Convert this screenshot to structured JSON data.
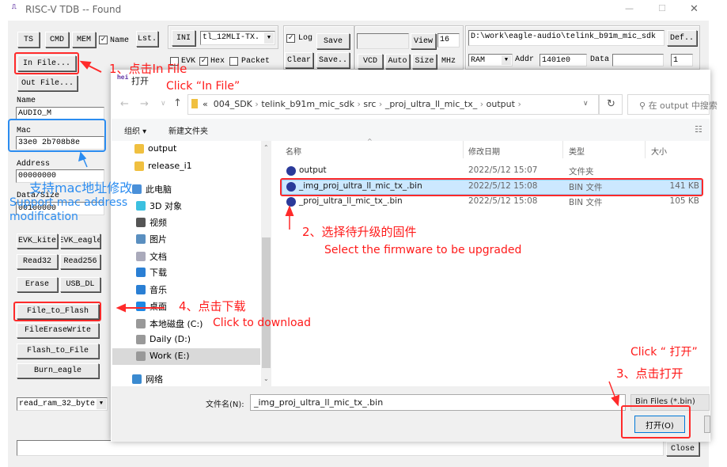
{
  "window": {
    "title": "RISC-V TDB -- Found",
    "logo": "hei",
    "minimize": "—",
    "maximize": "☐",
    "close": "✕"
  },
  "toolbar": {
    "ts": "TS",
    "cmd": "CMD",
    "mem": "MEM",
    "name_check": "Name",
    "name_checked": true,
    "lst": "Lst.",
    "ini": "INI",
    "ini_select": "tl_12MLI-TX.",
    "evk": "EVK",
    "evk_checked": false,
    "hex": "Hex",
    "hex_checked": true,
    "packet": "Packet",
    "packet_checked": false,
    "log": "Log",
    "log_checked": true,
    "save": "Save",
    "clear": "Clear",
    "save2": "Save..",
    "view": "View",
    "view_value": "16",
    "vcd": "VCD",
    "auto": "Auto",
    "size": "Size",
    "mhz": "MHz",
    "path": "D:\\work\\eagle-audio\\telink_b91m_mic_sdk",
    "def": "Def..",
    "mem_select": "RAM",
    "addr_label": "Addr",
    "addr_value": "1401e0",
    "data_label": "Data",
    "data_value": "",
    "count_value": "1"
  },
  "left": {
    "in_file": "In File...",
    "out_file": "Out File...",
    "name_label": "Name",
    "name_value": "AUDIO_M",
    "mac_label": "Mac",
    "mac_value": "33e0 2b708b8e",
    "address_label": "Address",
    "address_value": "00000000",
    "datasize_label": "Data/Size",
    "datasize_value": "00100000",
    "evk_kite": "EVK_kite",
    "evk_eagle": "EVK_eagle",
    "read32": "Read32",
    "read256": "Read256",
    "erase": "Erase",
    "usb_dl": "USB_DL",
    "file_to_flash": "File_to_Flash",
    "file_erase_write": "FileEraseWrite",
    "flash_to_file": "Flash_to_File",
    "burn_eagle": "Burn_eagle",
    "cmd_select": "read_ram_32_byte",
    "close": "Close"
  },
  "dialog": {
    "title": "打开",
    "breadcrumb": [
      "«",
      "004_SDK",
      "telink_b91m_mic_sdk",
      "src",
      "_proj_ultra_ll_mic_tx_",
      "output"
    ],
    "search_placeholder": "在 output 中搜索",
    "organize": "组织 ▾",
    "new_folder": "新建文件夹",
    "nav_items": [
      {
        "label": "output",
        "icon": "folder-icon"
      },
      {
        "label": "release_i1",
        "icon": "folder-icon"
      },
      {
        "label": "此电脑",
        "icon": "computer-icon"
      },
      {
        "label": "3D 对象",
        "icon": "cube-icon"
      },
      {
        "label": "视频",
        "icon": "video-icon"
      },
      {
        "label": "图片",
        "icon": "picture-icon"
      },
      {
        "label": "文档",
        "icon": "document-icon"
      },
      {
        "label": "下载",
        "icon": "download-icon"
      },
      {
        "label": "音乐",
        "icon": "music-icon"
      },
      {
        "label": "桌面",
        "icon": "desktop-icon"
      },
      {
        "label": "本地磁盘 (C:)",
        "icon": "drive-icon"
      },
      {
        "label": "Daily (D:)",
        "icon": "drive-icon"
      },
      {
        "label": "Work (E:)",
        "icon": "drive-icon",
        "selected": true
      },
      {
        "label": "网络",
        "icon": "network-icon"
      }
    ],
    "columns": [
      "名称",
      "修改日期",
      "类型",
      "大小"
    ],
    "files": [
      {
        "name": "output",
        "date": "2022/5/12 15:07",
        "type": "文件夹",
        "size": ""
      },
      {
        "name": "_img_proj_ultra_ll_mic_tx_.bin",
        "date": "2022/5/12 15:08",
        "type": "BIN 文件",
        "size": "141 KB",
        "selected": true
      },
      {
        "name": "_proj_ultra_ll_mic_tx_.bin",
        "date": "2022/5/12 15:08",
        "type": "BIN 文件",
        "size": "105 KB"
      }
    ],
    "filename_label": "文件名(N):",
    "filename_value": "_img_proj_ultra_ll_mic_tx_.bin",
    "filter": "Bin Files (*.bin)",
    "open": "打开(O)"
  },
  "annotations": {
    "step1_cn": "1、点击In File",
    "step1_en": "Click “In File”",
    "mac_cn": "支持mac地址修改",
    "mac_en": "Support mac address modification",
    "step2_cn": "2、选择待升级的固件",
    "step2_en": "Select the firmware to be upgraded",
    "step3_en": "Click “ 打开”",
    "step3_cn": "3、点击打开",
    "step4_cn": "4、点击下载",
    "step4_en": "Click to download",
    "red": "#ff1a1a",
    "blue": "#2b8cf0"
  }
}
